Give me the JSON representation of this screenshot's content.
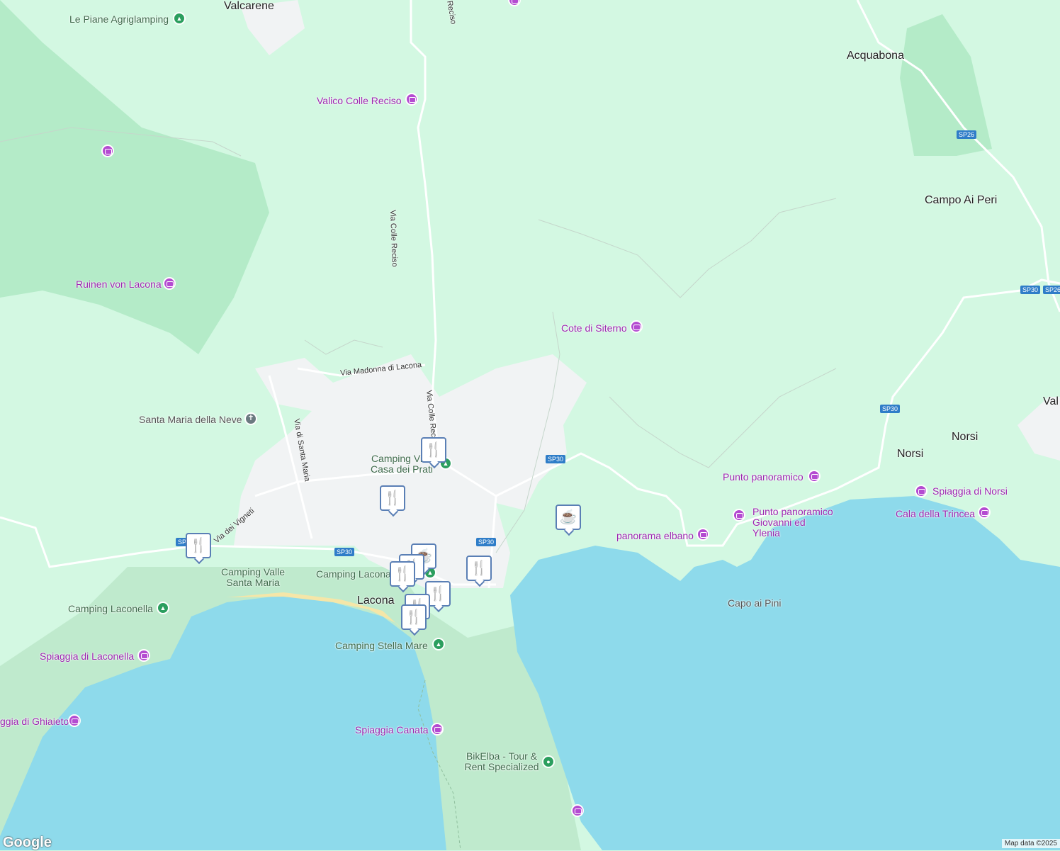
{
  "towns": [
    {
      "name": "Valcarene"
    },
    {
      "name": "Acquabona"
    },
    {
      "name": "Campo Ai Peri"
    },
    {
      "name": "Val"
    },
    {
      "name": "Norsi"
    },
    {
      "name": "Norsi"
    },
    {
      "name": "Lacona"
    }
  ],
  "pois": [
    {
      "name": "Valico Colle Reciso"
    },
    {
      "name": "Ruinen von Lacona"
    },
    {
      "name": "Cote di Siterno"
    },
    {
      "name": "Punto panoramico"
    },
    {
      "name": "Punto panoramico Giovanni ed Ylenia"
    },
    {
      "name": "Spiaggia di Norsi"
    },
    {
      "name": "Cala della Trincea"
    },
    {
      "name": "panorama elbano"
    },
    {
      "name": "Spiaggia di Laconella"
    },
    {
      "name": "ggia di Ghiaieto"
    },
    {
      "name": "Spiaggia Canata"
    }
  ],
  "campings": [
    {
      "name": "Le Piane Agriglamping"
    },
    {
      "name": "Camping Villa Casa dei Prati"
    },
    {
      "name": "Camping Valle Santa Maria"
    },
    {
      "name": "Camping Lacona"
    },
    {
      "name": "Camping Laconella"
    },
    {
      "name": "Camping Stella Mare"
    },
    {
      "name": "BikElba - Tour & Rent Specialized"
    }
  ],
  "church": {
    "name": "Santa Maria della Neve"
  },
  "cape": {
    "name": "Capo ai Pini"
  },
  "roads": [
    {
      "name": "Via Colle Reciso"
    },
    {
      "name": "Via Colle Reci"
    },
    {
      "name": "Via Madonna di Lacona"
    },
    {
      "name": "Via di Santa Maria"
    },
    {
      "name": "Via dei Vigneti"
    },
    {
      "name": "Reciso"
    }
  ],
  "shields": [
    "SP30",
    "SP30",
    "SP30",
    "SP30",
    "SP30",
    "SP26",
    "SP26",
    "SP30"
  ],
  "markers": {
    "restaurant_icon": "fork-knife-icon",
    "cafe_icon": "coffee-cup-icon"
  },
  "branding": {
    "logo": "Google",
    "attribution": "Map data ©2025"
  },
  "colors": {
    "land": "#d3f8e2",
    "forest": "#b4ebc8",
    "urban": "#f1f3f4",
    "water": "#8edaeb",
    "beach": "#f5e6a8",
    "poi": "#9c27b0",
    "camp": "#2b9e5e"
  }
}
